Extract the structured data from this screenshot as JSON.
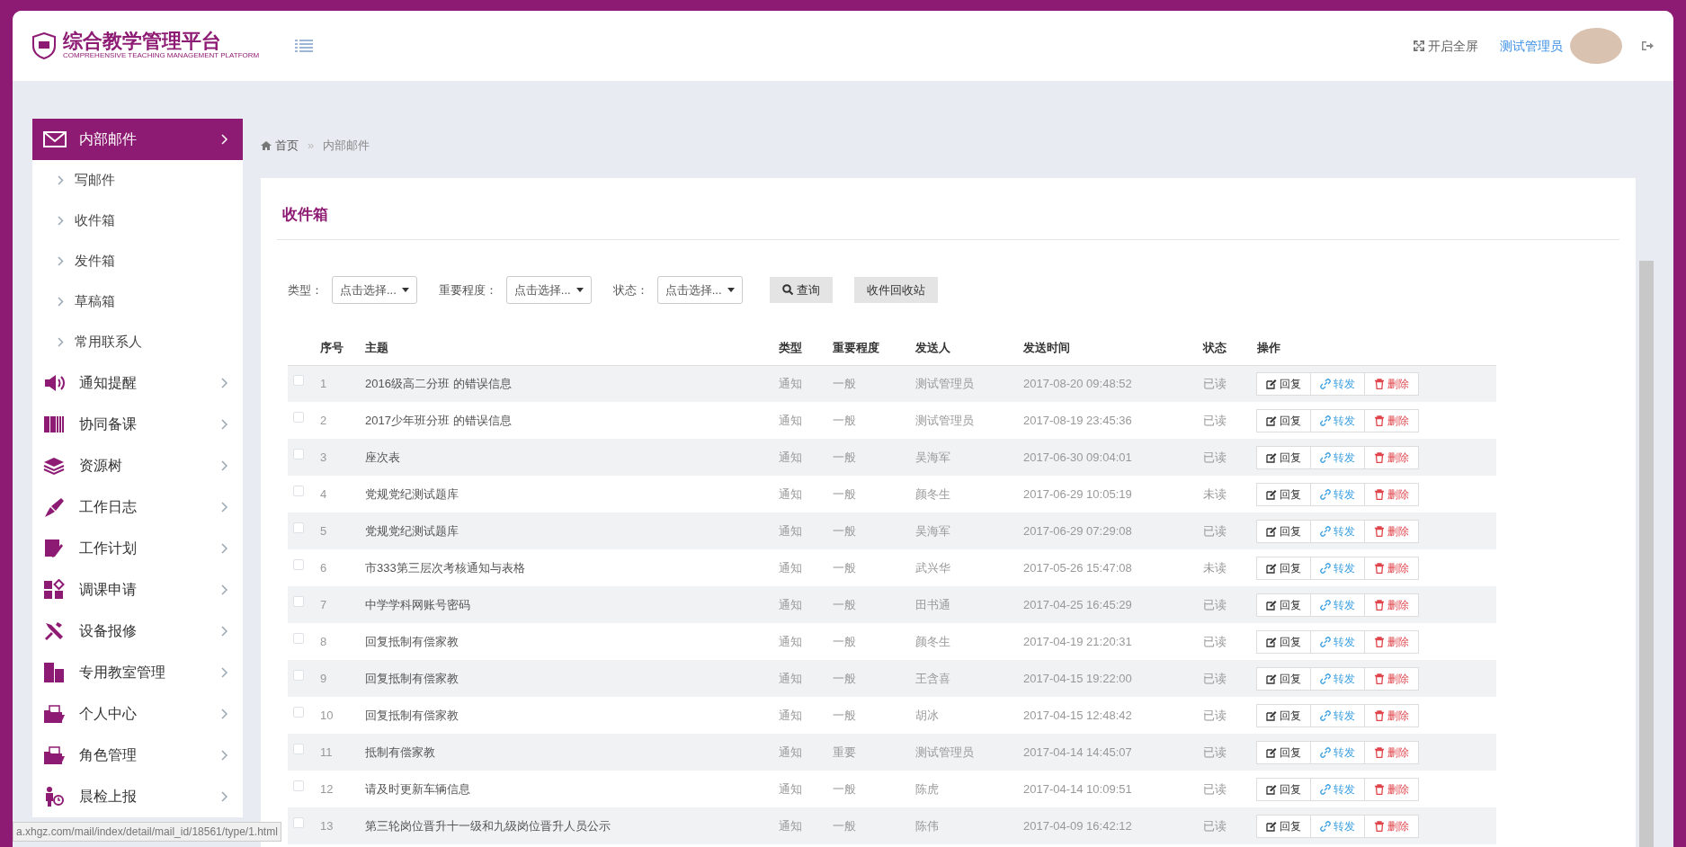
{
  "header": {
    "logo_title": "综合教学管理平台",
    "logo_subtitle": "COMPREHENSIVE TEACHING MANAGEMENT PLATFORM",
    "fullscreen": "开启全屏",
    "user": "测试管理员"
  },
  "sidebar": {
    "items": [
      {
        "label": "内部邮件",
        "selected": true,
        "children": [
          {
            "label": "写邮件"
          },
          {
            "label": "收件箱"
          },
          {
            "label": "发件箱"
          },
          {
            "label": "草稿箱"
          },
          {
            "label": "常用联系人"
          }
        ]
      },
      {
        "label": "通知提醒",
        "selected": false
      },
      {
        "label": "协同备课",
        "selected": false
      },
      {
        "label": "资源树",
        "selected": false
      },
      {
        "label": "工作日志",
        "selected": false
      },
      {
        "label": "工作计划",
        "selected": false
      },
      {
        "label": "调课申请",
        "selected": false
      },
      {
        "label": "设备报修",
        "selected": false
      },
      {
        "label": "专用教室管理",
        "selected": false
      },
      {
        "label": "个人中心",
        "selected": false
      },
      {
        "label": "角色管理",
        "selected": false
      },
      {
        "label": "晨检上报",
        "selected": false
      }
    ]
  },
  "breadcrumb": {
    "items": [
      "首页",
      "内部邮件"
    ],
    "separator": "»"
  },
  "panel": {
    "title": "收件箱",
    "filters": [
      {
        "label": "类型：",
        "value": "点击选择..."
      },
      {
        "label": "重要程度：",
        "value": "点击选择..."
      },
      {
        "label": "状态：",
        "value": "点击选择..."
      }
    ],
    "buttons": [
      {
        "kind": "search",
        "label": "查询"
      },
      {
        "kind": "plain",
        "label": "收件回收站"
      }
    ],
    "table": {
      "columns": [
        "序号",
        "主题",
        "类型",
        "重要程度",
        "发送人",
        "发送时间",
        "状态",
        "操作"
      ],
      "rows": [
        {
          "checked": false,
          "cells": [
            "1",
            "2016级高二分班 的错误信息",
            "通知",
            "一般",
            "测试管理员",
            "2017-08-20 09:48:52",
            "已读"
          ],
          "actions": [
            "回复",
            "转发",
            "删除"
          ]
        },
        {
          "checked": false,
          "cells": [
            "2",
            "2017少年班分班 的错误信息",
            "通知",
            "一般",
            "测试管理员",
            "2017-08-19 23:45:36",
            "已读"
          ],
          "actions": [
            "回复",
            "转发",
            "删除"
          ]
        },
        {
          "checked": false,
          "cells": [
            "3",
            "座次表",
            "通知",
            "一般",
            "吴海军",
            "2017-06-30 09:04:01",
            "已读"
          ],
          "actions": [
            "回复",
            "转发",
            "删除"
          ]
        },
        {
          "checked": false,
          "cells": [
            "4",
            "党规党纪测试题库",
            "通知",
            "一般",
            "颜冬生",
            "2017-06-29 10:05:19",
            "未读"
          ],
          "actions": [
            "回复",
            "转发",
            "删除"
          ]
        },
        {
          "checked": false,
          "cells": [
            "5",
            "党规党纪测试题库",
            "通知",
            "一般",
            "吴海军",
            "2017-06-29 07:29:08",
            "已读"
          ],
          "actions": [
            "回复",
            "转发",
            "删除"
          ]
        },
        {
          "checked": false,
          "cells": [
            "6",
            "市333第三层次考核通知与表格",
            "通知",
            "一般",
            "武兴华",
            "2017-05-26 15:47:08",
            "未读"
          ],
          "actions": [
            "回复",
            "转发",
            "删除"
          ]
        },
        {
          "checked": false,
          "cells": [
            "7",
            "中学学科网账号密码",
            "通知",
            "一般",
            "田书通",
            "2017-04-25 16:45:29",
            "已读"
          ],
          "actions": [
            "回复",
            "转发",
            "删除"
          ]
        },
        {
          "checked": false,
          "cells": [
            "8",
            "回复抵制有偿家教",
            "通知",
            "一般",
            "颜冬生",
            "2017-04-19 21:20:31",
            "已读"
          ],
          "actions": [
            "回复",
            "转发",
            "删除"
          ]
        },
        {
          "checked": false,
          "cells": [
            "9",
            "回复抵制有偿家教",
            "通知",
            "一般",
            "王含喜",
            "2017-04-15 19:22:00",
            "已读"
          ],
          "actions": [
            "回复",
            "转发",
            "删除"
          ]
        },
        {
          "checked": false,
          "cells": [
            "10",
            "回复抵制有偿家教",
            "通知",
            "一般",
            "胡冰",
            "2017-04-15 12:48:42",
            "已读"
          ],
          "actions": [
            "回复",
            "转发",
            "删除"
          ]
        },
        {
          "checked": false,
          "cells": [
            "11",
            "抵制有偿家教",
            "通知",
            "重要",
            "测试管理员",
            "2017-04-14 14:45:07",
            "已读"
          ],
          "actions": [
            "回复",
            "转发",
            "删除"
          ]
        },
        {
          "checked": false,
          "cells": [
            "12",
            "请及时更新车辆信息",
            "通知",
            "一般",
            "陈虎",
            "2017-04-14 10:09:51",
            "已读"
          ],
          "actions": [
            "回复",
            "转发",
            "删除"
          ]
        },
        {
          "checked": false,
          "cells": [
            "13",
            "第三轮岗位晋升十一级和九级岗位晋升人员公示",
            "通知",
            "一般",
            "陈伟",
            "2017-04-09 16:42:12",
            "已读"
          ],
          "actions": [
            "回复",
            "转发",
            "删除"
          ]
        }
      ]
    }
  },
  "status_url": "a.xhgz.com/mail/index/detail/mail_id/18561/type/1.html"
}
